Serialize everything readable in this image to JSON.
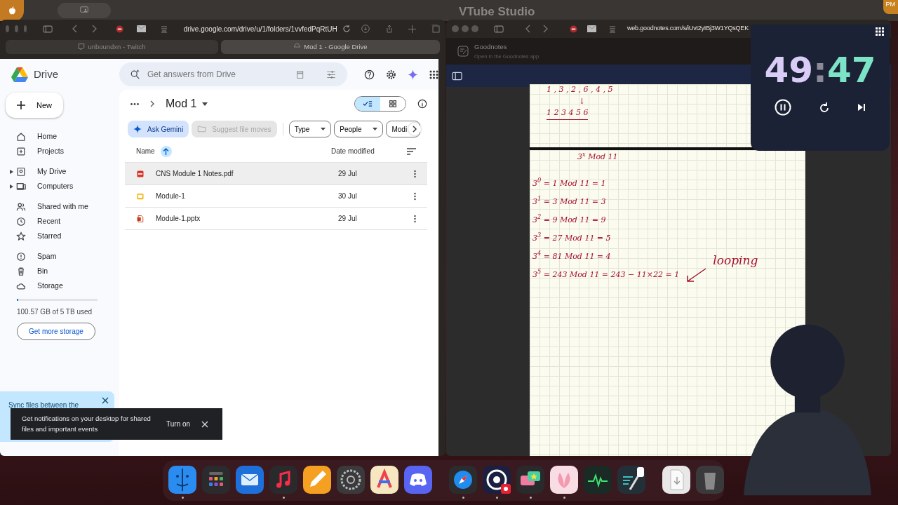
{
  "menu_bar": {
    "title": "VTube Studio",
    "clock": "PM"
  },
  "drive_window": {
    "url": "drive.google.com/drive/u/1/folders/1vvfedPqRtUH",
    "tabs": [
      {
        "label": "unboundxn - Twitch",
        "kind": "twitch",
        "selected": false
      },
      {
        "label": "Mod 1 - Google Drive",
        "kind": "drive",
        "selected": true
      }
    ],
    "app_name": "Drive",
    "search_placeholder": "Get answers from Drive",
    "new_button": "New",
    "sidebar_groups": [
      [
        {
          "label": "Home",
          "kind": "home",
          "expandable": false
        },
        {
          "label": "Projects",
          "kind": "projects",
          "expandable": false
        }
      ],
      [
        {
          "label": "My Drive",
          "kind": "mydrive",
          "expandable": true
        },
        {
          "label": "Computers",
          "kind": "computers",
          "expandable": true
        }
      ],
      [
        {
          "label": "Shared with me",
          "kind": "shared",
          "expandable": false
        },
        {
          "label": "Recent",
          "kind": "recent",
          "expandable": false
        },
        {
          "label": "Starred",
          "kind": "starred",
          "expandable": false
        }
      ],
      [
        {
          "label": "Spam",
          "kind": "spam",
          "expandable": false
        },
        {
          "label": "Bin",
          "kind": "bin",
          "expandable": false
        },
        {
          "label": "Storage",
          "kind": "storage",
          "expandable": false
        }
      ]
    ],
    "storage": {
      "level": 0.02,
      "text": "100.57 GB of 5 TB used",
      "button": "Get more storage"
    },
    "folder_title": "Mod 1",
    "views": [
      {
        "kind": "list",
        "selected": true
      },
      {
        "kind": "grid",
        "selected": false
      }
    ],
    "chips": [
      {
        "label": "Ask Gemini",
        "disabled": false
      },
      {
        "label": "Suggest file moves",
        "disabled": true
      }
    ],
    "filters": [
      "Type",
      "People",
      "Modi"
    ],
    "table": {
      "columns": [
        "Name",
        "Date modified"
      ],
      "rows": [
        {
          "name": "CNS Module 1 Notes.pdf",
          "date": "29 Jul",
          "kind": "pdf",
          "selected": true
        },
        {
          "name": "Module-1",
          "date": "30 Jul",
          "kind": "slides",
          "selected": false
        },
        {
          "name": "Module-1.pptx",
          "date": "29 Jul",
          "kind": "pptx",
          "selected": false
        }
      ]
    },
    "sync_banner": "Sync files between the",
    "toast": {
      "text": "Get notifications on your desktop for shared files and important events",
      "action": "Turn on"
    }
  },
  "goodnotes_window": {
    "url": "web.goodnotes.com/s/iUvt2yIBj3W1YQsQEK",
    "app_name": "Goodnotes",
    "subtitle": "Open in the Goodnotes app",
    "page_1": [
      {
        "text": "1 , 3 , 2 , 6 , 4 , 5",
        "underlined": false
      },
      {
        "text": "↓",
        "underlined": false
      },
      {
        "text": "1 2 3 4 5 6",
        "underlined": true
      }
    ],
    "page_2": {
      "title": "3$^{x}$ Mod 11",
      "lines": [
        "3$^{0}$ = 1 Mod 11 = 1",
        "3$^{1}$ = 3 Mod 11 = 3",
        "3$^{2}$ = 9 Mod 11 = 9",
        "3$^{3}$ = 27 Mod 11 = 5",
        "3$^{4}$ = 81 Mod 11 = 4",
        "3$^{5}$ = 243 Mod 11 = 243 − 11×22 = 1"
      ],
      "annotation": "looping"
    }
  },
  "timer": {
    "minutes": "49",
    "separator": ":",
    "seconds": "47"
  },
  "dock": {
    "groups": [
      [
        {
          "kind": "finder",
          "running": true
        },
        {
          "kind": "launchpad",
          "running": false
        },
        {
          "kind": "mail",
          "running": false
        },
        {
          "kind": "music",
          "running": true
        },
        {
          "kind": "pencil",
          "running": false
        },
        {
          "kind": "settings",
          "running": false
        },
        {
          "kind": "arc",
          "running": false
        },
        {
          "kind": "discord",
          "running": false
        }
      ],
      [
        {
          "kind": "safari",
          "running": true
        },
        {
          "kind": "obs",
          "running": true
        },
        {
          "kind": "chat",
          "running": true
        },
        {
          "kind": "petal",
          "running": true
        },
        {
          "kind": "activity",
          "running": false
        },
        {
          "kind": "pen",
          "running": false
        }
      ],
      [
        {
          "kind": "downloads",
          "running": false
        },
        {
          "kind": "trash",
          "running": false
        }
      ]
    ]
  }
}
